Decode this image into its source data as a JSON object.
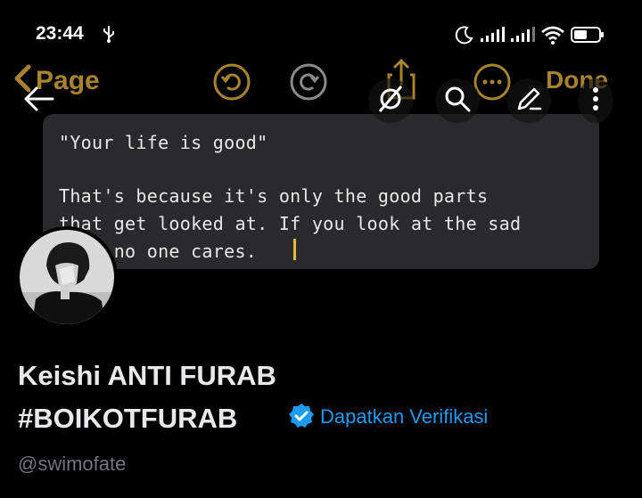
{
  "status_bar": {
    "time": "23:44",
    "icons": [
      "usb-icon",
      "moon-icon",
      "signal-icon",
      "signal-icon",
      "wifi-icon",
      "battery-icon"
    ]
  },
  "banner": {
    "notes_toolbar": {
      "back_label": "Page",
      "done_label": "Done",
      "icons": [
        "undo-icon",
        "redo-icon",
        "share-icon",
        "more-dots-icon"
      ],
      "accent_color": "#a8822c"
    },
    "note": {
      "line1": "\"Your life is good\"",
      "line2": "That's because it's only the good parts",
      "line3": "that get looked at. If you look at the sad",
      "line4": "     no one cares."
    }
  },
  "header": {
    "icons": [
      "back-arrow-icon",
      "grok-icon",
      "search-icon",
      "compose-icon",
      "overflow-icon"
    ]
  },
  "profile": {
    "name_line1": "Keishi ANTI FURAB",
    "name_line2": "#BOIKOTFURAB",
    "verification_link": "Dapatkan Verifikasi",
    "handle": "@swimofate",
    "link_color": "#1d9bf0"
  }
}
